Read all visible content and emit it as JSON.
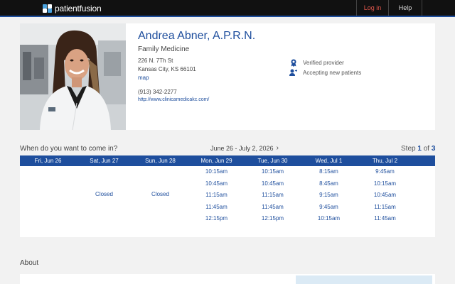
{
  "header": {
    "brand_first": "patient",
    "brand_second": "fusion",
    "login_label": "Log in",
    "help_label": "Help",
    "colors": {
      "bar": "#111111",
      "accent": "#1e4e9d",
      "login": "#e2574c"
    }
  },
  "provider": {
    "name": "Andrea Abner, A.P.R.N.",
    "specialty": "Family Medicine",
    "address_line1": "226 N. 7Th St",
    "address_line2": "Kansas City, KS 66101",
    "map_label": "map",
    "phone": "(913) 342-2277",
    "website": "http://www.clinicamedicakc.com/",
    "badges": [
      {
        "label": "Verified provider",
        "icon": "ribbon-icon"
      },
      {
        "label": "Accepting new patients",
        "icon": "person-plus-icon"
      }
    ]
  },
  "schedule": {
    "prompt": "When do you want to come in?",
    "date_range": "June 26 - July 2, 2026",
    "step_prefix": "Step",
    "step_current": "1",
    "step_of": "of",
    "step_total": "3",
    "days": [
      {
        "label": "Fri, Jun 26",
        "slots": [],
        "closed": ""
      },
      {
        "label": "Sat, Jun 27",
        "slots": [],
        "closed": "Closed"
      },
      {
        "label": "Sun, Jun 28",
        "slots": [],
        "closed": "Closed"
      },
      {
        "label": "Mon, Jun 29",
        "slots": [
          "10:15am",
          "10:45am",
          "11:15am",
          "11:45am",
          "12:15pm"
        ],
        "closed": ""
      },
      {
        "label": "Tue, Jun 30",
        "slots": [
          "10:15am",
          "10:45am",
          "11:15am",
          "11:45am",
          "12:15pm"
        ],
        "closed": ""
      },
      {
        "label": "Wed, Jul 1",
        "slots": [
          "8:15am",
          "8:45am",
          "9:15am",
          "9:45am",
          "10:15am"
        ],
        "closed": ""
      },
      {
        "label": "Thu, Jul 2",
        "slots": [
          "9:45am",
          "10:15am",
          "10:45am",
          "11:15am",
          "11:45am"
        ],
        "closed": ""
      }
    ]
  },
  "about": {
    "title": "About"
  }
}
